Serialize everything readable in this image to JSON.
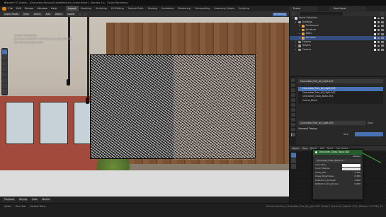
{
  "window": {
    "title": "Blender* [C:\\Users\\...\\Chocolate_Factory\\Crystal\\Kitchen_Scene.blend] - Blender 3.x - Cycles Rendering"
  },
  "menubar": {
    "menus": [
      "File",
      "Edit",
      "Render",
      "Window",
      "Help"
    ],
    "workspaces": [
      "Layout",
      "Modeling",
      "Sculpting",
      "UV Editing",
      "Texture Paint",
      "Shading",
      "Animation",
      "Rendering",
      "Compositing",
      "Geometry Nodes",
      "Scripting"
    ],
    "active_workspace": "Layout",
    "scene": "Scene",
    "view_layer": "View Layer"
  },
  "viewport": {
    "header": {
      "mode": "Object Mode",
      "view": "View",
      "select": "Select",
      "add": "Add",
      "object": "Object",
      "orientation": "Global",
      "shading": "Rendering"
    },
    "overlay_text": [
      "Camera Perspective",
      "(1) Scene Collection | Chocolate_Free_All_Light.003",
      "Path Tracing Sample 5/16"
    ],
    "bottom": {
      "playback": "Playback",
      "keying": "Keying",
      "view": "View",
      "marker": "Marker"
    }
  },
  "outliner": {
    "title": "Scene Collection",
    "items": [
      {
        "label": "Scene Collection",
        "level": 0,
        "color": "#d0d0d0",
        "selected": false
      },
      {
        "label": "Buildings",
        "level": 1,
        "color": "#9a9a9a",
        "selected": false
      },
      {
        "label": "Conference",
        "level": 2,
        "color": "#e8a34a",
        "selected": false
      },
      {
        "label": "Furniture",
        "level": 2,
        "color": "#e8a34a",
        "selected": false
      },
      {
        "label": "Walls",
        "level": 2,
        "color": "#e8a34a",
        "selected": false
      },
      {
        "label": "Windows",
        "level": 2,
        "color": "#e8a34a",
        "selected": true
      },
      {
        "label": "Exterior",
        "level": 1,
        "color": "#9a9a9a",
        "selected": false
      },
      {
        "label": "Helpers",
        "level": 1,
        "color": "#9a9a9a",
        "selected": false
      },
      {
        "label": "Camera",
        "level": 1,
        "color": "#9a9a9a",
        "selected": false
      }
    ]
  },
  "properties": {
    "material_slots": [
      "Chocolate_Free_All_Light.003",
      "Chocolate_Free_All_Light.002",
      "Chocolate_Glass_Basic.004",
      "Crema_Blend"
    ],
    "selected_slot": 0,
    "material_name": "Chocolate_Free_All_Light.003",
    "data_label": "Data",
    "section": "Viewport Display",
    "size_label": "Size"
  },
  "shader": {
    "header": [
      "Object",
      "View",
      "Select",
      "Add",
      "Node",
      "Use Nodes"
    ],
    "node": {
      "title": "Chocolate_Glass_Basic.004",
      "output": "Shader",
      "material_field": "Chocolate_Glass_Basic.0...",
      "inputs": [
        {
          "label": "Color Main",
          "value": "",
          "color": "#ffffff"
        },
        {
          "label": "Color Shadow",
          "value": "",
          "color": "#e6e6e6"
        },
        {
          "label": "Glass_IOR",
          "value": "1.150"
        },
        {
          "label": "Glass_Roughness",
          "value": "0.300"
        },
        {
          "label": "Reflection_Strength",
          "value": "1.000"
        },
        {
          "label": "Reflection_Roughness",
          "value": "0.200"
        }
      ]
    }
  },
  "statusbar": {
    "items": [
      "Select",
      "Pan View",
      "Context Menu"
    ],
    "right": "Scene Collection | Chocolate_Free_All_Light.003 | Verts 0 | Faces 0 | Objects 1/31 | Memory 2.5 GiB | 3.x"
  }
}
